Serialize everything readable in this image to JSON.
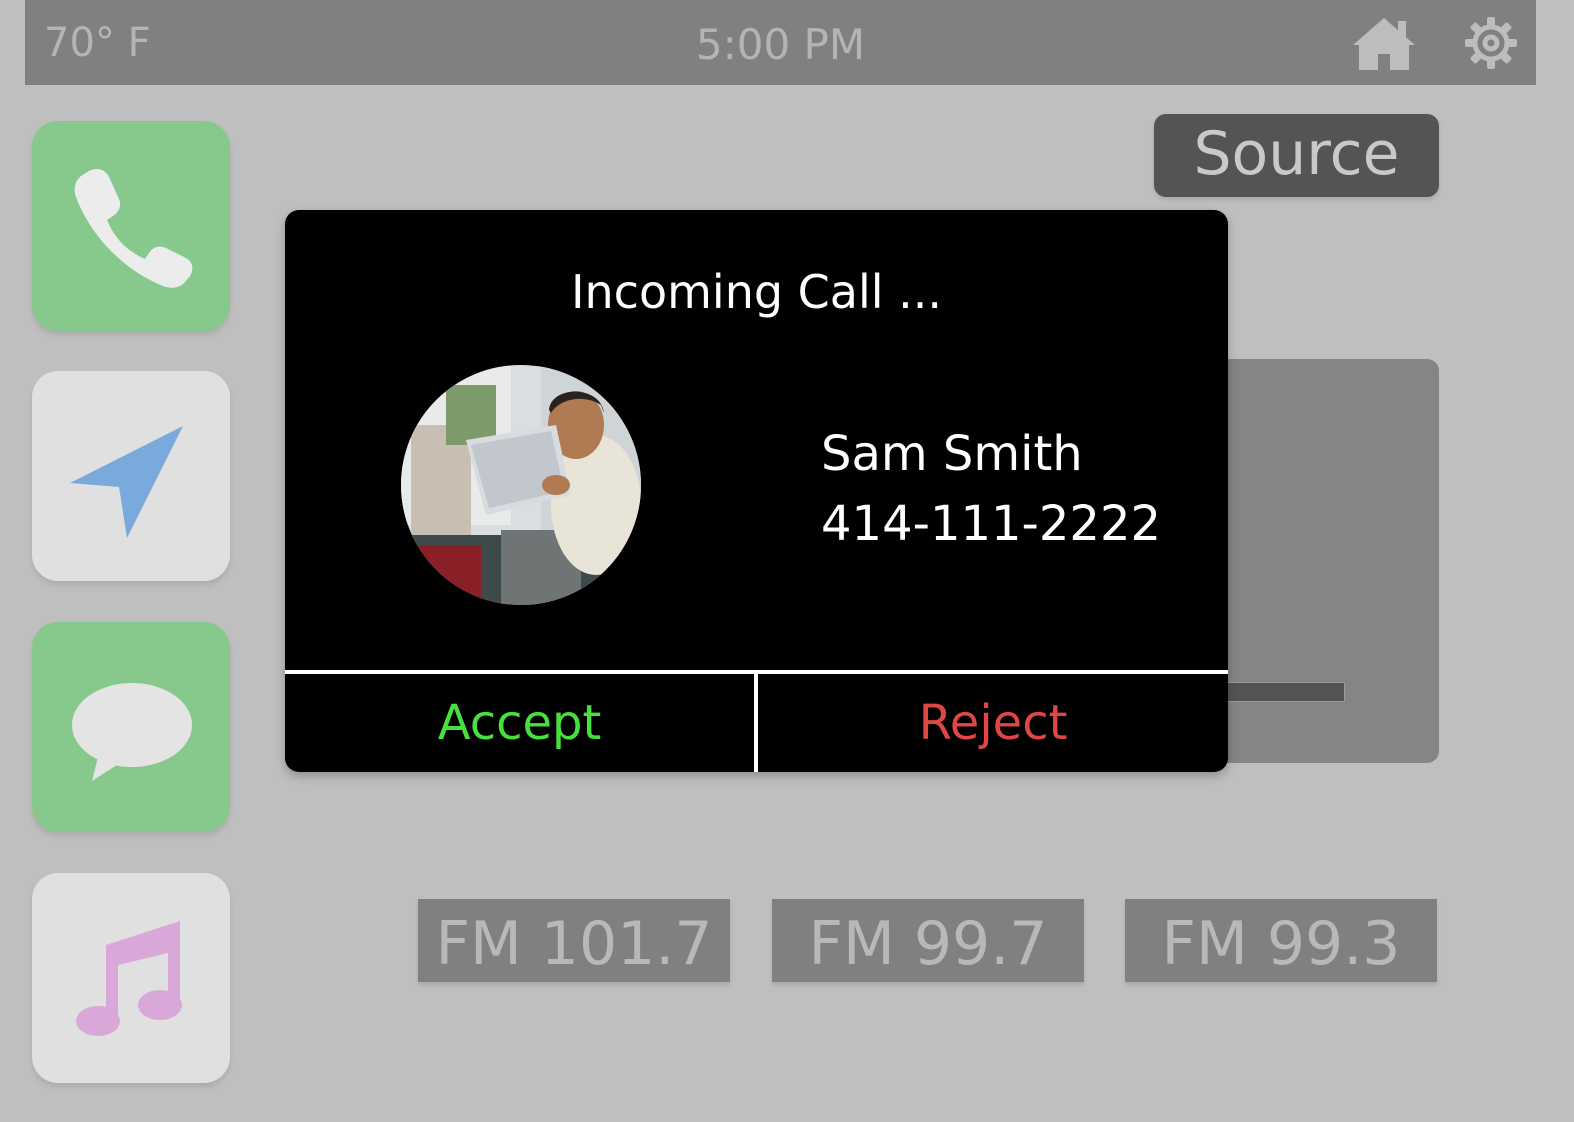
{
  "status_bar": {
    "temperature": "70° F",
    "time": "5:00 PM",
    "icons": [
      "home-icon",
      "gear-icon"
    ]
  },
  "dock": {
    "items": [
      {
        "name": "phone",
        "icon": "phone-icon",
        "color": "#87c98c"
      },
      {
        "name": "navigation",
        "icon": "navigation-arrow-icon",
        "color": "#7aa9dc"
      },
      {
        "name": "messages",
        "icon": "chat-bubble-icon",
        "color": "#87c98c"
      },
      {
        "name": "music",
        "icon": "music-note-icon",
        "color": "#d9a8d8"
      }
    ]
  },
  "media": {
    "source_label": "Source",
    "stations": [
      "FM 101.7",
      "FM 99.7",
      "FM 99.3"
    ]
  },
  "incoming_call": {
    "title": "Incoming Call ...",
    "caller_name": "Sam Smith",
    "caller_number": "414-111-2222",
    "accept_label": "Accept",
    "reject_label": "Reject",
    "accept_color": "#47e13f",
    "reject_color": "#e04646"
  }
}
